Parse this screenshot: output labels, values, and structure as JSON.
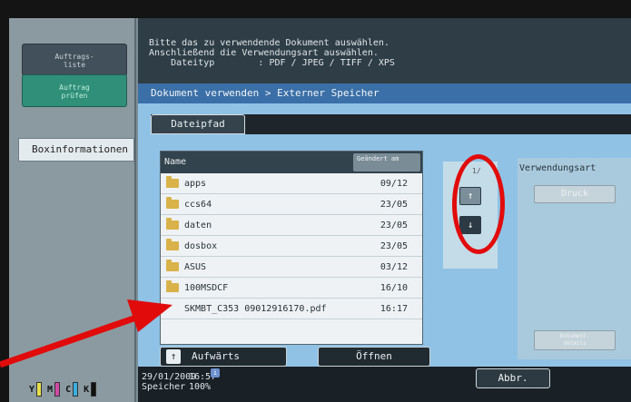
{
  "left_panel": {
    "auftragsliste": "Auftrags-\nliste",
    "auftrag_pruefen": "Auftrag\nprüfen",
    "boxinfo": "Boxinformationen",
    "inks": [
      "Y",
      "M",
      "C",
      "K"
    ]
  },
  "instructions": {
    "text": "Bitte das zu verwendende Dokument auswählen.\nAnschließend die Verwendungsart auswählen.\n    Dateityp        : PDF / JPEG / TIFF / XPS"
  },
  "header": {
    "breadcrumb": "Dokument verwenden > Externer Speicher"
  },
  "path_tab": {
    "label": "Dateipfad"
  },
  "filelist": {
    "col_name": "Name",
    "col_date": "Geändert am",
    "rows": [
      {
        "name": "apps",
        "date": "09/12",
        "folder": true
      },
      {
        "name": "ccs64",
        "date": "23/05",
        "folder": true
      },
      {
        "name": "daten",
        "date": "23/05",
        "folder": true
      },
      {
        "name": "dosbox",
        "date": "23/05",
        "folder": true
      },
      {
        "name": "ASUS",
        "date": "03/12",
        "folder": true
      },
      {
        "name": "100MSDCF",
        "date": "16/10",
        "folder": true
      },
      {
        "name": "SKMBT_C353 09012916170.pdf",
        "date": "16:17",
        "folder": false
      }
    ]
  },
  "scroll": {
    "page": "1/",
    "up": "↑",
    "down": "↓"
  },
  "right_panel": {
    "label": "Verwendungsart",
    "druck": "Druck",
    "details": "Dokument-\ndetails"
  },
  "buttons": {
    "aufwaerts": "Aufwärts",
    "oeffnen": "Öffnen",
    "abbr": "Abbr."
  },
  "status": {
    "date": "29/01/2009\nSpeicher",
    "time": "16:57\n100%"
  },
  "colors": {
    "annotation_red": "#e10b0b",
    "header_blue": "#3a6fa8"
  }
}
